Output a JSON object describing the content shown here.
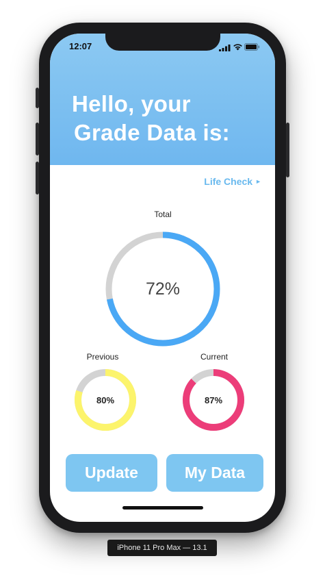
{
  "status_bar": {
    "time": "12:07"
  },
  "header": {
    "line1": "Hello, your",
    "line2": "Grade Data is:",
    "background": "#7fbff2"
  },
  "life_check": {
    "label": "Life Check",
    "arrow": "►"
  },
  "gauges": {
    "total": {
      "label": "Total",
      "percent_label": "72%",
      "value": 0.72,
      "color": "#4aa8f5",
      "track": "#d3d3d3"
    },
    "previous": {
      "label": "Previous",
      "percent_label": "80%",
      "value": 0.8,
      "color": "#fcf46c",
      "track": "#d3d3d3"
    },
    "current": {
      "label": "Current",
      "percent_label": "87%",
      "value": 0.87,
      "color": "#ec3d79",
      "track": "#d3d3d3"
    }
  },
  "buttons": {
    "update": "Update",
    "my_data": "My Data",
    "color": "#7ec6f1"
  },
  "device_label": "iPhone 11 Pro Max — 13.1"
}
